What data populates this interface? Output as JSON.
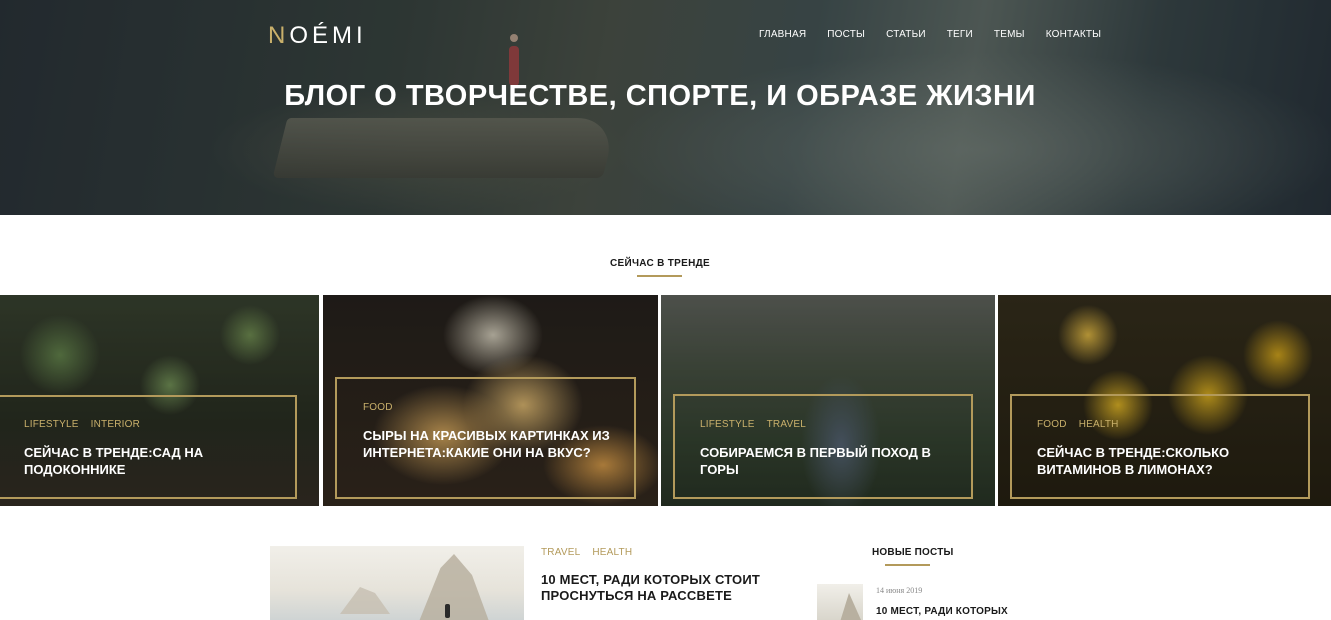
{
  "brand": {
    "logo_first": "N",
    "logo_rest": "OÉMI"
  },
  "nav": [
    "ГЛАВНАЯ",
    "ПОСТЫ",
    "СТАТЬИ",
    "ТЕГИ",
    "ТЕМЫ",
    "КОНТАКТЫ"
  ],
  "hero": {
    "title": "БЛОГ О ТВОРЧЕСТВЕ, СПОРТЕ, И ОБРАЗЕ ЖИЗНИ"
  },
  "trending": {
    "heading": "СЕЙЧАС В ТРЕНДЕ",
    "cards": [
      {
        "tags": [
          "LIFESTYLE",
          "INTERIOR"
        ],
        "title": "СЕЙЧАС В ТРЕНДЕ:САД НА ПОДОКОННИКЕ"
      },
      {
        "tags": [
          "FOOD"
        ],
        "title": "СЫРЫ НА КРАСИВЫХ КАРТИНКАХ ИЗ ИНТЕРНЕТА:КАКИЕ ОНИ НА ВКУС?"
      },
      {
        "tags": [
          "LIFESTYLE",
          "TRAVEL"
        ],
        "title": "СОБИРАЕМСЯ В ПЕРВЫЙ ПОХОД В ГОРЫ"
      },
      {
        "tags": [
          "FOOD",
          "HEALTH"
        ],
        "title": "СЕЙЧАС В ТРЕНДЕ:СКОЛЬКО ВИТАМИНОВ В ЛИМОНАХ?"
      }
    ]
  },
  "featured_post": {
    "tags": [
      "TRAVEL",
      "HEALTH"
    ],
    "title": "10 МЕСТ, РАДИ КОТОРЫХ СТОИТ ПРОСНУТЬСЯ НА РАССВЕТЕ"
  },
  "sidebar": {
    "heading": "НОВЫЕ ПОСТЫ",
    "items": [
      {
        "date": "14 июня 2019",
        "title": "10 МЕСТ, РАДИ КОТОРЫХ"
      }
    ]
  },
  "colors": {
    "accent": "#b39a5b",
    "logo_accent": "#c9b06b",
    "text": "#1a1a1a",
    "white": "#ffffff"
  }
}
